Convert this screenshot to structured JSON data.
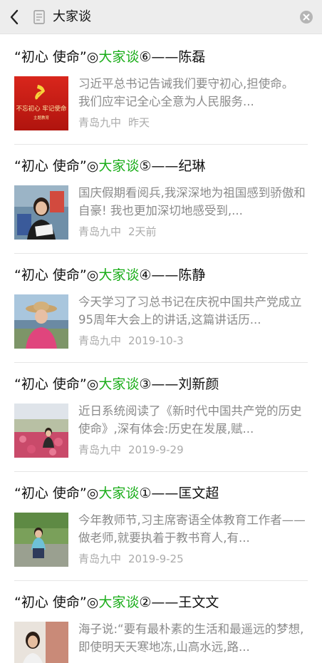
{
  "search": {
    "query": "大家谈"
  },
  "icons": {
    "back": "chevron-left-icon",
    "doc": "document-icon",
    "clear": "clear-x-icon"
  },
  "colors": {
    "highlight": "#1aad19",
    "searchbar_bg": "#ededed",
    "meta_text": "#ababab",
    "snippet_text": "#8a8a8a"
  },
  "articles": [
    {
      "title_pre": "“初心 使命”◎",
      "title_hl": "大家谈",
      "title_post": "⑥——陈磊",
      "snippet": "习近平总书记告诫我们要守初心,担使命。 我们应牢记全心全意为人民服务...",
      "source": "青岛九中",
      "time": "昨天",
      "thumb_text": "不忘初心  牢记使命",
      "thumb_sub": "主题教育"
    },
    {
      "title_pre": "“初心 使命”◎",
      "title_hl": "大家谈",
      "title_post": "⑤——纪琳",
      "snippet": "国庆假期看阅兵,我深深地为祖国感到骄傲和自豪! 我也更加深切地感受到,...",
      "source": "青岛九中",
      "time": "2天前"
    },
    {
      "title_pre": "“初心 使命”◎",
      "title_hl": "大家谈",
      "title_post": "④——陈静",
      "snippet": "今天学习了习总书记在庆祝中国共产党成立95周年大会上的讲话,这篇讲话历...",
      "source": "青岛九中",
      "time": "2019-10-3"
    },
    {
      "title_pre": "“初心 使命”◎",
      "title_hl": "大家谈",
      "title_post": "③——刘新颜",
      "snippet": "近日系统阅读了《新时代中国共产党的历史使命》,深有体会:历史在发展,赋...",
      "source": "青岛九中",
      "time": "2019-9-29"
    },
    {
      "title_pre": "“初心 使命”◎",
      "title_hl": "大家谈",
      "title_post": "①——匡文超",
      "snippet": "今年教师节,习主席寄语全体教育工作者——做老师,就要执着于教书育人,有...",
      "source": "青岛九中",
      "time": "2019-9-25"
    },
    {
      "title_pre": "“初心 使命”◎",
      "title_hl": "大家谈",
      "title_post": "②——王文文",
      "snippet": "海子说:“要有最朴素的生活和最遥远的梦想,即使明天天寒地冻,山高水远,路...",
      "source": "",
      "time": ""
    }
  ]
}
